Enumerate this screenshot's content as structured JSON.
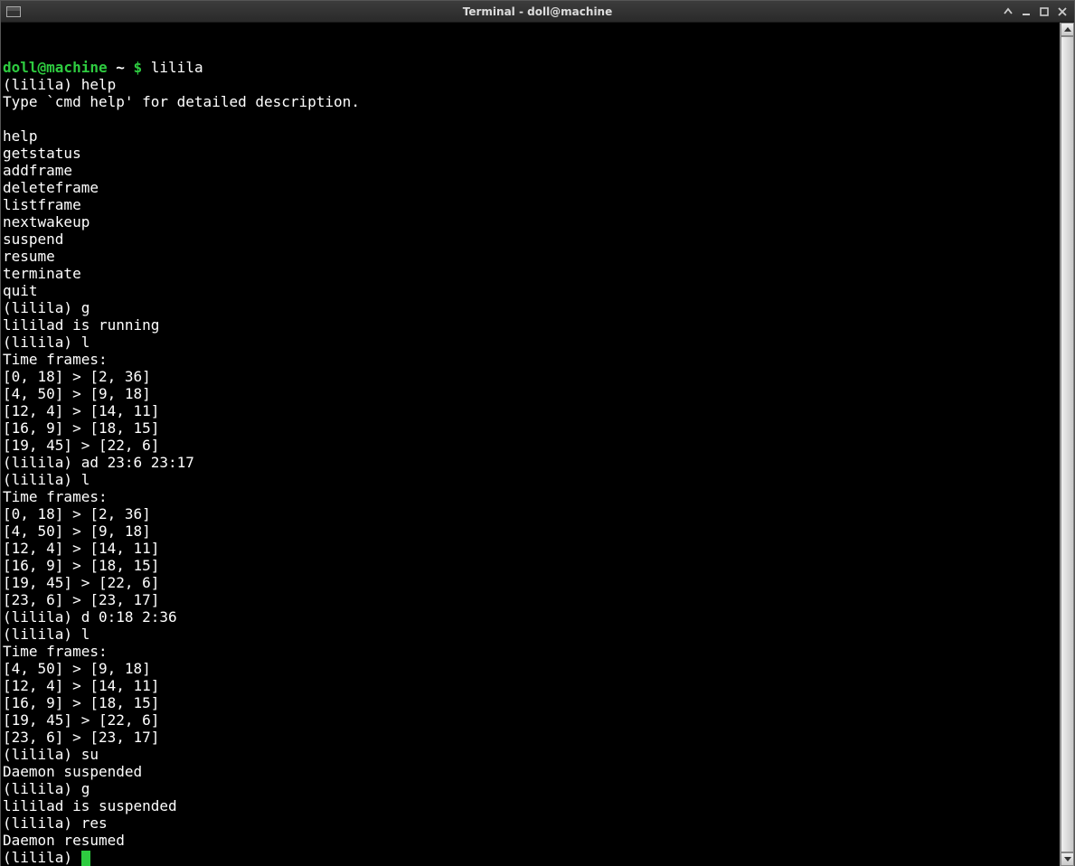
{
  "window": {
    "title": "Terminal - doll@machine"
  },
  "prompt": {
    "user_host": "doll@machine",
    "path": "~",
    "symbol": "$",
    "command": "lilila"
  },
  "lilila_prompt": "(lilila) ",
  "session": [
    {
      "type": "input",
      "text": "help"
    },
    {
      "type": "output",
      "text": "Type `cmd help' for detailed description."
    },
    {
      "type": "blank"
    },
    {
      "type": "output",
      "text": "help"
    },
    {
      "type": "output",
      "text": "getstatus"
    },
    {
      "type": "output",
      "text": "addframe"
    },
    {
      "type": "output",
      "text": "deleteframe"
    },
    {
      "type": "output",
      "text": "listframe"
    },
    {
      "type": "output",
      "text": "nextwakeup"
    },
    {
      "type": "output",
      "text": "suspend"
    },
    {
      "type": "output",
      "text": "resume"
    },
    {
      "type": "output",
      "text": "terminate"
    },
    {
      "type": "output",
      "text": "quit"
    },
    {
      "type": "input",
      "text": "g"
    },
    {
      "type": "output",
      "text": "lililad is running"
    },
    {
      "type": "input",
      "text": "l"
    },
    {
      "type": "output",
      "text": "Time frames:"
    },
    {
      "type": "output",
      "text": "[0, 18] > [2, 36]"
    },
    {
      "type": "output",
      "text": "[4, 50] > [9, 18]"
    },
    {
      "type": "output",
      "text": "[12, 4] > [14, 11]"
    },
    {
      "type": "output",
      "text": "[16, 9] > [18, 15]"
    },
    {
      "type": "output",
      "text": "[19, 45] > [22, 6]"
    },
    {
      "type": "input",
      "text": "ad 23:6 23:17"
    },
    {
      "type": "input",
      "text": "l"
    },
    {
      "type": "output",
      "text": "Time frames:"
    },
    {
      "type": "output",
      "text": "[0, 18] > [2, 36]"
    },
    {
      "type": "output",
      "text": "[4, 50] > [9, 18]"
    },
    {
      "type": "output",
      "text": "[12, 4] > [14, 11]"
    },
    {
      "type": "output",
      "text": "[16, 9] > [18, 15]"
    },
    {
      "type": "output",
      "text": "[19, 45] > [22, 6]"
    },
    {
      "type": "output",
      "text": "[23, 6] > [23, 17]"
    },
    {
      "type": "input",
      "text": "d 0:18 2:36"
    },
    {
      "type": "input",
      "text": "l"
    },
    {
      "type": "output",
      "text": "Time frames:"
    },
    {
      "type": "output",
      "text": "[4, 50] > [9, 18]"
    },
    {
      "type": "output",
      "text": "[12, 4] > [14, 11]"
    },
    {
      "type": "output",
      "text": "[16, 9] > [18, 15]"
    },
    {
      "type": "output",
      "text": "[19, 45] > [22, 6]"
    },
    {
      "type": "output",
      "text": "[23, 6] > [23, 17]"
    },
    {
      "type": "input",
      "text": "su"
    },
    {
      "type": "output",
      "text": "Daemon suspended"
    },
    {
      "type": "input",
      "text": "g"
    },
    {
      "type": "output",
      "text": "lililad is suspended"
    },
    {
      "type": "input",
      "text": "res"
    },
    {
      "type": "output",
      "text": "Daemon resumed"
    },
    {
      "type": "cursor"
    }
  ]
}
